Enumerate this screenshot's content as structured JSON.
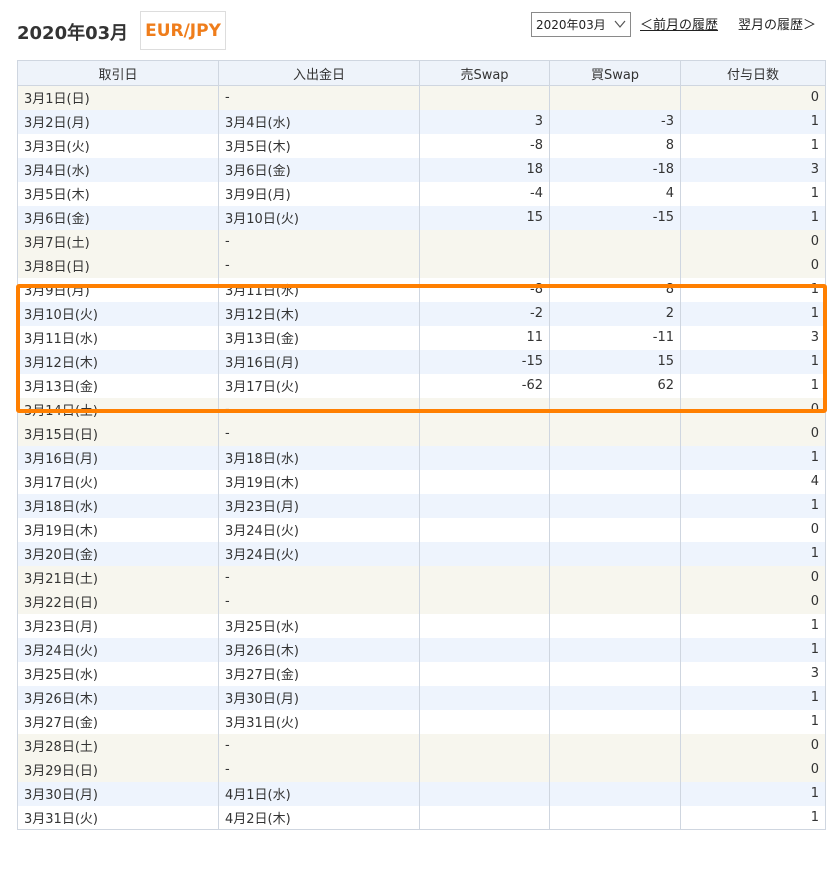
{
  "header": {
    "title": "2020年03月",
    "pair": "EUR/JPY",
    "month_select": "2020年03月",
    "prev_link": "＜前月の履歴",
    "next_link": "翌月の履歴＞"
  },
  "table": {
    "columns": [
      "取引日",
      "入出金日",
      "売Swap",
      "買Swap",
      "付与日数"
    ],
    "rows": [
      {
        "trade": "3月1日(日)",
        "settle": "-",
        "sell": "",
        "buy": "",
        "days": "0",
        "kind": "weekend"
      },
      {
        "trade": "3月2日(月)",
        "settle": "3月4日(水)",
        "sell": "3",
        "buy": "-3",
        "days": "1",
        "kind": "even"
      },
      {
        "trade": "3月3日(火)",
        "settle": "3月5日(木)",
        "sell": "-8",
        "buy": "8",
        "days": "1",
        "kind": "odd"
      },
      {
        "trade": "3月4日(水)",
        "settle": "3月6日(金)",
        "sell": "18",
        "buy": "-18",
        "days": "3",
        "kind": "even"
      },
      {
        "trade": "3月5日(木)",
        "settle": "3月9日(月)",
        "sell": "-4",
        "buy": "4",
        "days": "1",
        "kind": "odd"
      },
      {
        "trade": "3月6日(金)",
        "settle": "3月10日(火)",
        "sell": "15",
        "buy": "-15",
        "days": "1",
        "kind": "even"
      },
      {
        "trade": "3月7日(土)",
        "settle": "-",
        "sell": "",
        "buy": "",
        "days": "0",
        "kind": "weekend"
      },
      {
        "trade": "3月8日(日)",
        "settle": "-",
        "sell": "",
        "buy": "",
        "days": "0",
        "kind": "weekend"
      },
      {
        "trade": "3月9日(月)",
        "settle": "3月11日(水)",
        "sell": "-8",
        "buy": "8",
        "days": "1",
        "kind": "odd"
      },
      {
        "trade": "3月10日(火)",
        "settle": "3月12日(木)",
        "sell": "-2",
        "buy": "2",
        "days": "1",
        "kind": "even"
      },
      {
        "trade": "3月11日(水)",
        "settle": "3月13日(金)",
        "sell": "11",
        "buy": "-11",
        "days": "3",
        "kind": "odd"
      },
      {
        "trade": "3月12日(木)",
        "settle": "3月16日(月)",
        "sell": "-15",
        "buy": "15",
        "days": "1",
        "kind": "even"
      },
      {
        "trade": "3月13日(金)",
        "settle": "3月17日(火)",
        "sell": "-62",
        "buy": "62",
        "days": "1",
        "kind": "odd"
      },
      {
        "trade": "3月14日(土)",
        "settle": "-",
        "sell": "",
        "buy": "",
        "days": "0",
        "kind": "weekend"
      },
      {
        "trade": "3月15日(日)",
        "settle": "-",
        "sell": "",
        "buy": "",
        "days": "0",
        "kind": "weekend"
      },
      {
        "trade": "3月16日(月)",
        "settle": "3月18日(水)",
        "sell": "",
        "buy": "",
        "days": "1",
        "kind": "even"
      },
      {
        "trade": "3月17日(火)",
        "settle": "3月19日(木)",
        "sell": "",
        "buy": "",
        "days": "4",
        "kind": "odd"
      },
      {
        "trade": "3月18日(水)",
        "settle": "3月23日(月)",
        "sell": "",
        "buy": "",
        "days": "1",
        "kind": "even"
      },
      {
        "trade": "3月19日(木)",
        "settle": "3月24日(火)",
        "sell": "",
        "buy": "",
        "days": "0",
        "kind": "odd"
      },
      {
        "trade": "3月20日(金)",
        "settle": "3月24日(火)",
        "sell": "",
        "buy": "",
        "days": "1",
        "kind": "even"
      },
      {
        "trade": "3月21日(土)",
        "settle": "-",
        "sell": "",
        "buy": "",
        "days": "0",
        "kind": "weekend"
      },
      {
        "trade": "3月22日(日)",
        "settle": "-",
        "sell": "",
        "buy": "",
        "days": "0",
        "kind": "weekend"
      },
      {
        "trade": "3月23日(月)",
        "settle": "3月25日(水)",
        "sell": "",
        "buy": "",
        "days": "1",
        "kind": "odd"
      },
      {
        "trade": "3月24日(火)",
        "settle": "3月26日(木)",
        "sell": "",
        "buy": "",
        "days": "1",
        "kind": "even"
      },
      {
        "trade": "3月25日(水)",
        "settle": "3月27日(金)",
        "sell": "",
        "buy": "",
        "days": "3",
        "kind": "odd"
      },
      {
        "trade": "3月26日(木)",
        "settle": "3月30日(月)",
        "sell": "",
        "buy": "",
        "days": "1",
        "kind": "even"
      },
      {
        "trade": "3月27日(金)",
        "settle": "3月31日(火)",
        "sell": "",
        "buy": "",
        "days": "1",
        "kind": "odd"
      },
      {
        "trade": "3月28日(土)",
        "settle": "-",
        "sell": "",
        "buy": "",
        "days": "0",
        "kind": "weekend"
      },
      {
        "trade": "3月29日(日)",
        "settle": "-",
        "sell": "",
        "buy": "",
        "days": "0",
        "kind": "weekend"
      },
      {
        "trade": "3月30日(月)",
        "settle": "4月1日(水)",
        "sell": "",
        "buy": "",
        "days": "1",
        "kind": "even"
      },
      {
        "trade": "3月31日(火)",
        "settle": "4月2日(木)",
        "sell": "",
        "buy": "",
        "days": "1",
        "kind": "odd"
      }
    ]
  },
  "colors": {
    "accent_orange": "#ff7f00",
    "pair_orange": "#ef7d1b",
    "header_bg": "#eef3fa",
    "weekend_bg": "#f7f6ee",
    "row_blue": "#eef4fd"
  }
}
